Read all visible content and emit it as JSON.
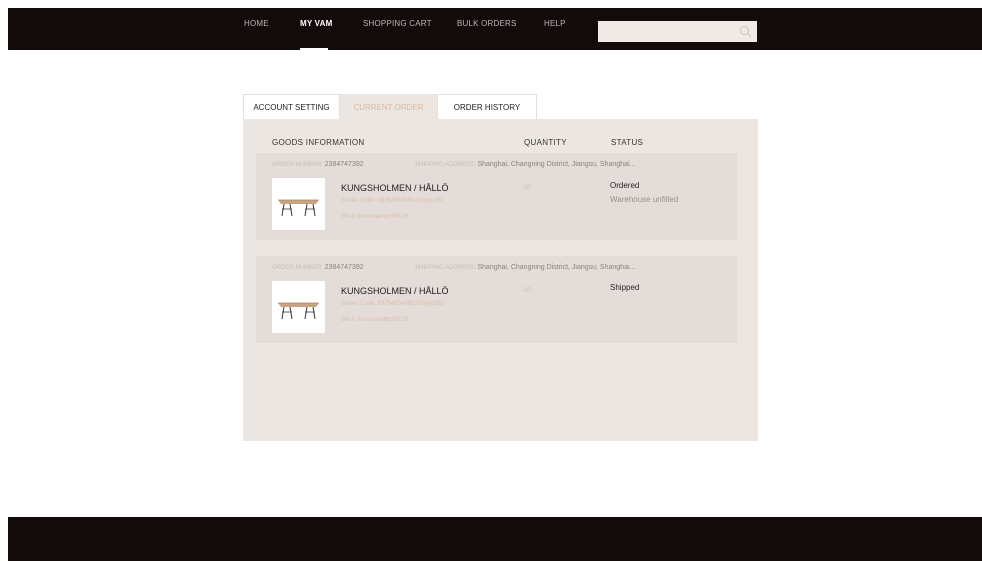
{
  "nav": {
    "items": [
      {
        "label": "HOME"
      },
      {
        "label": "MY VAM"
      },
      {
        "label": "SHOPPING CART"
      },
      {
        "label": "BULK ORDERS"
      },
      {
        "label": "HELP"
      }
    ],
    "active": "MY VAM",
    "search_value": "",
    "search_icon": "search-icon"
  },
  "tabs": [
    {
      "label": "ACCOUNT SETTING"
    },
    {
      "label": "CURRENT ORDER"
    },
    {
      "label": "ORDER HISTORY"
    }
  ],
  "table": {
    "headers": {
      "goods": "GOODS INFORMATION",
      "quantity": "QUANTITY",
      "status": "STATUS"
    }
  },
  "orders": [
    {
      "order_label": "ORDER NUMBER:",
      "order_number": "2384747392",
      "address_label": "SHIPPING ADDRESS:",
      "address": "Shanghai, Changning District, Jiangsu,  Shanghai...",
      "product_name": "KUNGSHOLMEN / HÅLLÖ",
      "stores_code": "Stores Code: 9375465459d267yyb262",
      "sku": "SKU: dsincvaanbci90129",
      "quantity": "10",
      "status": "Ordered",
      "status_detail": "Warehouse unfilled"
    },
    {
      "order_label": "ORDER NUMBER:",
      "order_number": "2384747392",
      "address_label": "SHIPPING ADDRESS:",
      "address": "Shanghai, Changning District, Jiangsu,  Shanghai...",
      "product_name": "KUNGSHOLMEN / HÅLLÖ",
      "stores_code": "Stores Code: 9375465459d267yyb262",
      "sku": "SKU: dsincvaanbci90129",
      "quantity": "10",
      "status": "Shipped",
      "status_detail": ""
    }
  ],
  "colors": {
    "topbar": "#120b0a",
    "panel": "#ebe6e1",
    "order_card": "#e4dcd8",
    "accent": "#d9bfa8"
  }
}
